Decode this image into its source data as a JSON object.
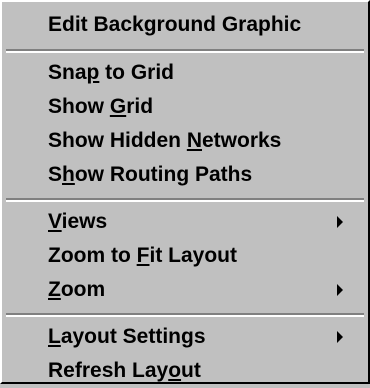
{
  "menu": {
    "groups": [
      {
        "items": [
          {
            "id": "edit-background-graphic",
            "label": "Edit Background Graphic",
            "pre": "Edit Background Graphic",
            "accel": "",
            "post": "",
            "submenu": false
          }
        ]
      },
      {
        "items": [
          {
            "id": "snap-to-grid",
            "label": "Snap to Grid",
            "pre": "Sna",
            "accel": "p",
            "post": " to Grid",
            "submenu": false
          },
          {
            "id": "show-grid",
            "label": "Show Grid",
            "pre": "Show ",
            "accel": "G",
            "post": "rid",
            "submenu": false
          },
          {
            "id": "show-hidden-networks",
            "label": "Show Hidden Networks",
            "pre": "Show Hidden ",
            "accel": "N",
            "post": "etworks",
            "submenu": false
          },
          {
            "id": "show-routing-paths",
            "label": "Show Routing Paths",
            "pre": "S",
            "accel": "h",
            "post": "ow Routing Paths",
            "submenu": false
          }
        ]
      },
      {
        "items": [
          {
            "id": "views",
            "label": "Views",
            "pre": "",
            "accel": "V",
            "post": "iews",
            "submenu": true
          },
          {
            "id": "zoom-to-fit-layout",
            "label": "Zoom to Fit Layout",
            "pre": "Zoom to ",
            "accel": "F",
            "post": "it Layout",
            "submenu": false
          },
          {
            "id": "zoom",
            "label": "Zoom",
            "pre": "",
            "accel": "Z",
            "post": "oom",
            "submenu": true
          }
        ]
      },
      {
        "items": [
          {
            "id": "layout-settings",
            "label": "Layout Settings",
            "pre": "",
            "accel": "L",
            "post": "ayout Settings",
            "submenu": true
          },
          {
            "id": "refresh-layout",
            "label": "Refresh Layout",
            "pre": "Refresh Lay",
            "accel": "o",
            "post": "ut",
            "submenu": false
          }
        ]
      }
    ]
  }
}
